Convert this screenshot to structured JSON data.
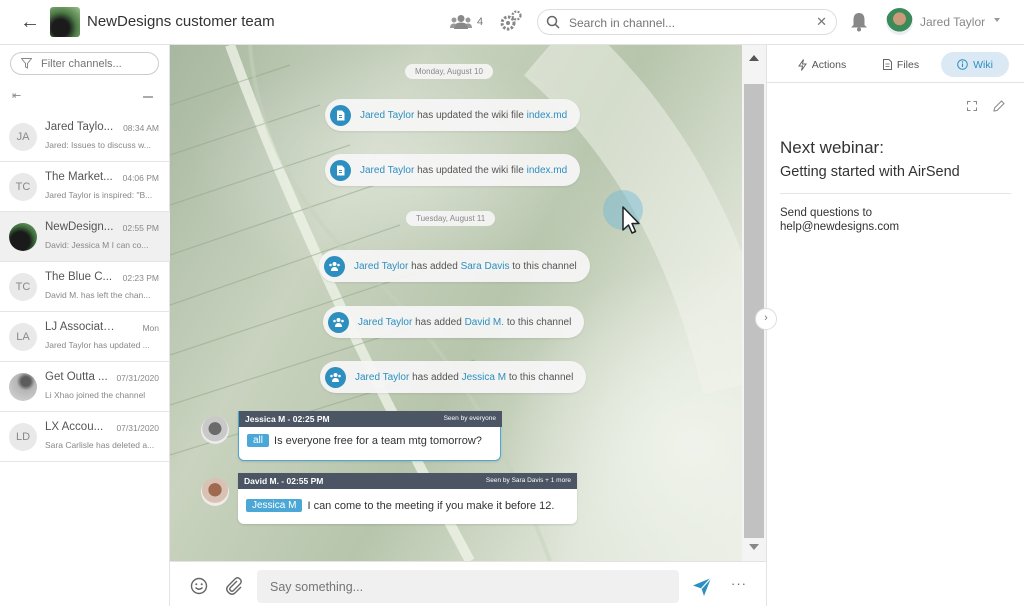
{
  "header": {
    "title": "NewDesigns customer team",
    "member_count": "4",
    "search_placeholder": "Search in channel...",
    "user_name": "Jared Taylor"
  },
  "sidebar": {
    "filter_placeholder": "Filter channels...",
    "channels": [
      {
        "initials": "JA",
        "name": "Jared Taylo...",
        "time": "08:34 AM",
        "preview": "Jared: Issues to discuss w..."
      },
      {
        "initials": "TC",
        "name": "The Market...",
        "time": "04:06 PM",
        "preview": "Jared Taylor is inspired: \"B..."
      },
      {
        "initials": "",
        "name": "NewDesign...",
        "time": "02:55 PM",
        "preview": "David: Jessica M I can co..."
      },
      {
        "initials": "TC",
        "name": "The Blue C...",
        "time": "02:23 PM",
        "preview": "David M. has left the chan..."
      },
      {
        "initials": "LA",
        "name": "LJ Associates",
        "time": "Mon",
        "preview": "Jared Taylor has updated ..."
      },
      {
        "initials": "",
        "name": "Get Outta ...",
        "time": "07/31/2020",
        "preview": "Li Xhao joined the channel"
      },
      {
        "initials": "LD",
        "name": "LX Accou...",
        "time": "07/31/2020",
        "preview": "Sara Carlisle has deleted a..."
      }
    ]
  },
  "chat": {
    "dates": [
      "Monday, August 10",
      "Tuesday, August 11"
    ],
    "events": [
      {
        "actor": "Jared Taylor",
        "text": "has updated the wiki file",
        "target": "index.md",
        "suffix": ""
      },
      {
        "actor": "Jared Taylor",
        "text": "has updated the wiki file",
        "target": "index.md",
        "suffix": ""
      },
      {
        "actor": "Jared Taylor",
        "text": "has added",
        "target": "Sara Davis",
        "suffix": "to this channel"
      },
      {
        "actor": "Jared Taylor",
        "text": "has added",
        "target": "David M.",
        "suffix": "to this channel"
      },
      {
        "actor": "Jared Taylor",
        "text": "has added",
        "target": "Jessica M",
        "suffix": "to this channel"
      }
    ],
    "messages": [
      {
        "header": "Jessica M - 02:25 PM",
        "seen": "Seen by everyone",
        "mention": "all",
        "text": "Is everyone free for a team mtg tomorrow?"
      },
      {
        "header": "David M. - 02:55 PM",
        "seen": "Seen by Sara Davis + 1 more",
        "mention": "Jessica M",
        "text": "I can come to the meeting if you make it before 12."
      }
    ],
    "composer_placeholder": "Say something...",
    "more_label": "···"
  },
  "panel": {
    "tabs": [
      "Actions",
      "Files",
      "Wiki"
    ],
    "active_tab": "Wiki",
    "wiki": {
      "heading": "Next webinar:",
      "subheading": "Getting started with AirSend",
      "body": "Send questions to help@newdesigns.com"
    }
  },
  "colors": {
    "accent": "#2d8fc0",
    "mention": "#4ba8d6",
    "bubble_header": "#4b5563"
  }
}
